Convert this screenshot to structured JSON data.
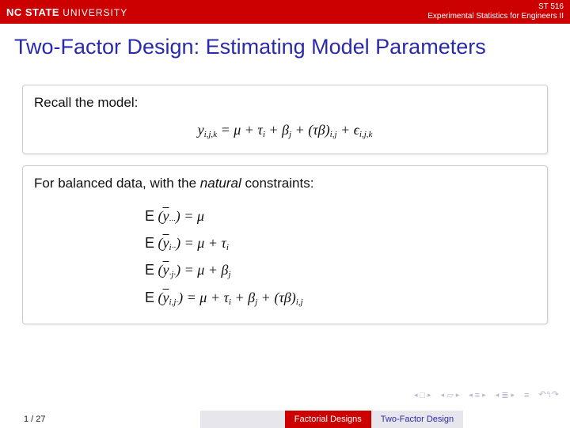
{
  "header": {
    "logo_main": "NC STATE",
    "logo_sub": "UNIVERSITY",
    "course_code": "ST 516",
    "course_name": "Experimental Statistics for Engineers II"
  },
  "title": "Two-Factor Design: Estimating Model Parameters",
  "block1": {
    "intro": "Recall the model:",
    "equation": "y",
    "eq_sub": "i,j,k",
    "eq_rhs": " = μ + τ",
    "eq_tau_sub": "i",
    "eq_plus_beta": " + β",
    "eq_beta_sub": "j",
    "eq_plus_tb": " + (τβ)",
    "eq_tb_sub": "i,j",
    "eq_plus_eps": " + ϵ",
    "eq_eps_sub": "i,j,k"
  },
  "block2": {
    "intro_a": "For balanced data, with the ",
    "intro_em": "natural",
    "intro_b": " constraints:",
    "lines": [
      {
        "lhs_y_sub": "···",
        "rhs": " = μ"
      },
      {
        "lhs_y_sub": "i··",
        "rhs": " = μ + τ",
        "rhs_sub": "i"
      },
      {
        "lhs_y_sub": "·j·",
        "rhs": " = μ + β",
        "rhs_sub": "j"
      },
      {
        "lhs_y_sub": "i,j·",
        "rhs": " = μ + τ",
        "rhs_sub": "i",
        "rhs2": " + β",
        "rhs2_sub": "j",
        "rhs3": " + (τβ)",
        "rhs3_sub": "i,j"
      }
    ]
  },
  "footer": {
    "page": "1 / 27",
    "section": "Factorial Designs",
    "subsection": "Two-Factor Design"
  }
}
